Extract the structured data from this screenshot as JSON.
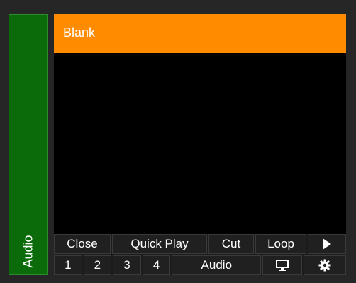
{
  "side_tab": {
    "label": "Audio",
    "color": "#0b6b0b"
  },
  "title_bar": {
    "label": "Blank",
    "color": "#ff8c00"
  },
  "controls": {
    "row1": {
      "close": "Close",
      "quick_play": "Quick Play",
      "cut": "Cut",
      "loop": "Loop",
      "play_icon": "play-icon"
    },
    "row2": {
      "one": "1",
      "two": "2",
      "three": "3",
      "four": "4",
      "audio": "Audio",
      "monitor_icon": "monitor-icon",
      "gear_icon": "gear-icon"
    }
  }
}
